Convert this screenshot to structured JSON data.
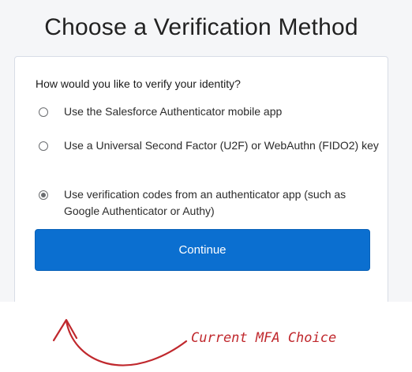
{
  "header": {
    "title": "Choose a Verification Method"
  },
  "form": {
    "prompt": "How would you like to verify your identity?",
    "options": [
      {
        "label": "Use the Salesforce Authenticator mobile app",
        "selected": false
      },
      {
        "label": "Use a Universal Second Factor (U2F) or WebAuthn (FIDO2) key",
        "selected": false
      },
      {
        "label": "Use verification codes from an authenticator app (such as Google Authenticator or Authy)",
        "selected": true
      }
    ],
    "continue_label": "Continue"
  },
  "annotation": {
    "text": "Current MFA Choice",
    "color": "#c0282d"
  },
  "colors": {
    "primary_button": "#0b6fd0",
    "card_border": "#d8dde6"
  }
}
